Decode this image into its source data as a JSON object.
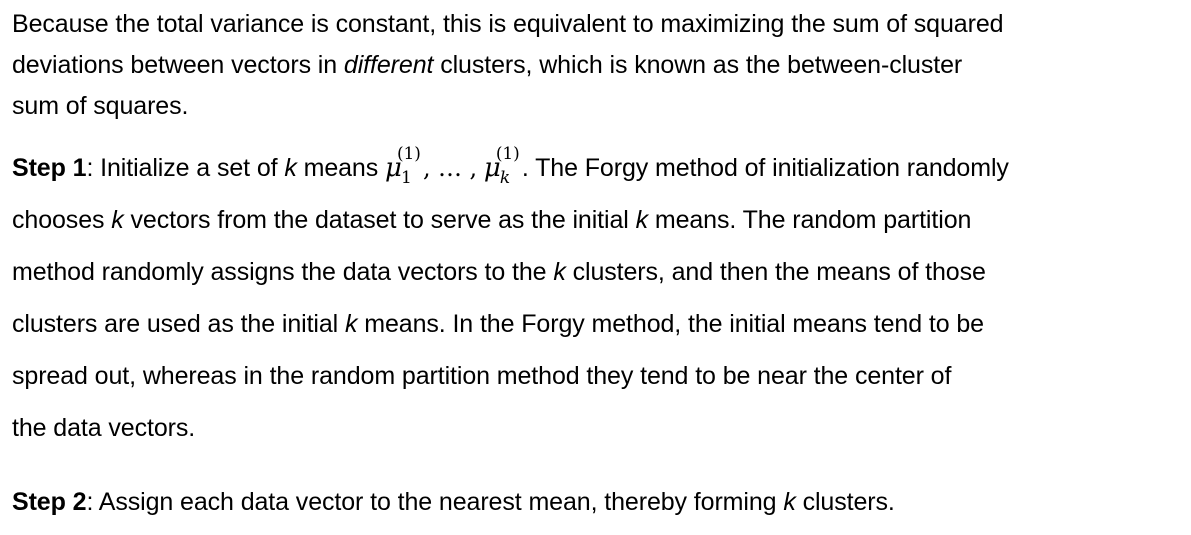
{
  "paragraph1": {
    "line1": "Because the total variance is constant, this is equivalent to maximizing the sum of squared",
    "line2_pre": "deviations between vectors in ",
    "line2_em": "different",
    "line2_post": " clusters, which is known as the between-cluster",
    "line3": "sum of squares."
  },
  "step1": {
    "label": "Step 1",
    "colon": ": Initialize a set of ",
    "k": "k",
    "means_text": " means ",
    "mu": "μ",
    "sup": "(1)",
    "sub1": "1",
    "subk": "k",
    "sep": ", … ,",
    "after_math": ". The Forgy method of initialization randomly",
    "line2_pre": "chooses ",
    "line2_mid": " vectors from the dataset to serve as the initial ",
    "line2_post": " means. The random partition",
    "line3_pre": "method randomly assigns the data vectors to the ",
    "line3_post": " clusters, and then the means of those",
    "line4_pre": "clusters are used as the initial ",
    "line4_post": " means. In the Forgy method, the initial means tend to be",
    "line5": "spread out, whereas in the random partition method they tend to be near the center of",
    "line6": "the data vectors."
  },
  "step2": {
    "label": "Step 2",
    "text_pre": ": Assign each data vector to the nearest mean, thereby forming ",
    "k": "k",
    "text_post": " clusters."
  }
}
